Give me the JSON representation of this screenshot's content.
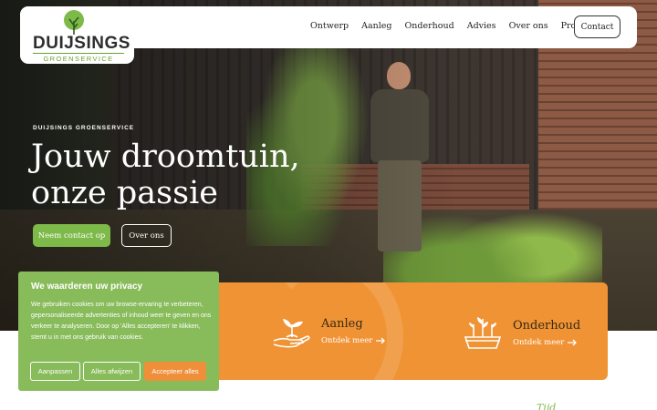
{
  "brand": {
    "name": "DUIJSINGS",
    "tagline": "GROENSERVICE",
    "green": "#7dba4a",
    "orange": "#ef9335"
  },
  "nav": {
    "items": [
      "Ontwerp",
      "Aanleg",
      "Onderhoud",
      "Advies",
      "Over ons",
      "Projecten"
    ],
    "contact_label": "Contact"
  },
  "hero": {
    "eyebrow": "DUIJSINGS GROENSERVICE",
    "headline_line1": "Jouw droomtuin,",
    "headline_line2": "onze passie",
    "primary_button": "Neem contact op",
    "secondary_button": "Over ons"
  },
  "services": [
    {
      "title": "Aanleg",
      "link": "Ontdek meer",
      "icon": "hand-planting-icon"
    },
    {
      "title": "Onderhoud",
      "link": "Ontdek meer",
      "icon": "planter-box-icon"
    }
  ],
  "cookie": {
    "title": "We waarderen uw privacy",
    "text": "We gebruiken cookies om uw browse-ervaring te verbeteren, gepersonaliseerde advertenties of inhoud weer te geven en ons verkeer te analyseren. Door op 'Alles accepteren' te klikken, stemt u in met ons gebruik van cookies.",
    "btn_customize": "Aanpassen",
    "btn_reject": "Alles afwijzen",
    "btn_accept": "Accepteer alles"
  },
  "peek_text": "Tijd"
}
